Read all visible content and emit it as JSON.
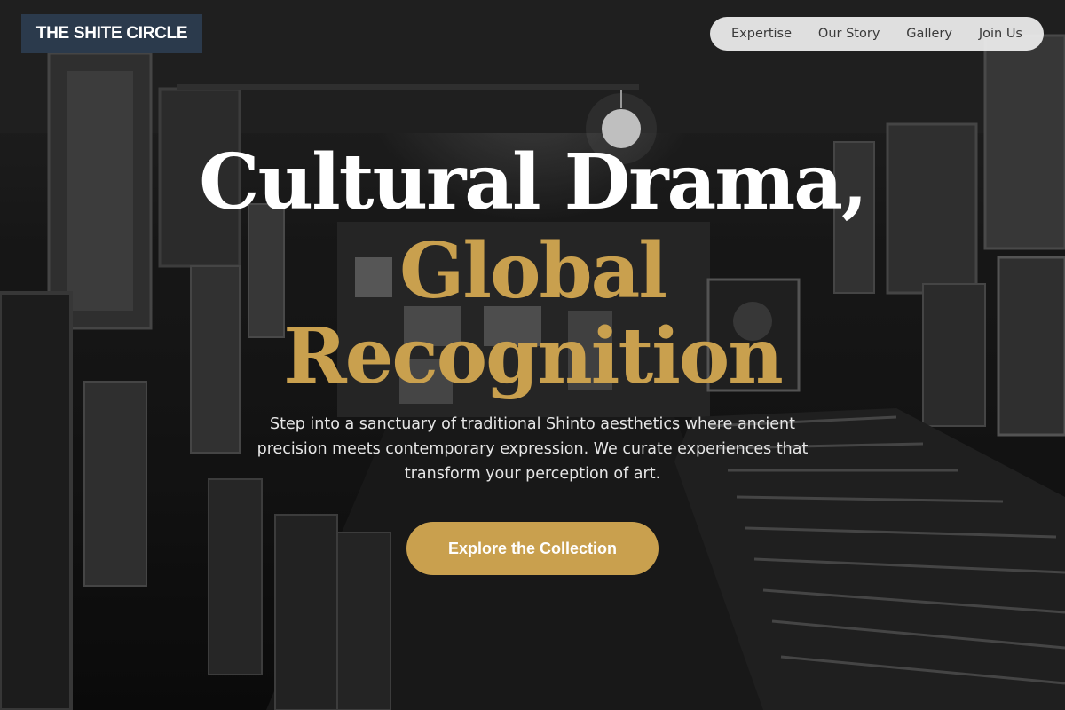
{
  "brand": {
    "logo_text": "THE SHITE CIRCLE",
    "logo_bg": "#2b3a4c"
  },
  "nav": {
    "items": [
      {
        "label": "Expertise"
      },
      {
        "label": "Our Story"
      },
      {
        "label": "Gallery"
      },
      {
        "label": "Join Us"
      }
    ]
  },
  "hero": {
    "headline_line1": "Cultural Drama,",
    "headline_line2": "Global",
    "headline_line3": "Recognition",
    "subtitle": "Step into a sanctuary of traditional Shinto aesthetics where ancient precision meets contemporary expression. We curate experiences that transform your perception of art.",
    "cta_label": "Explore the Collection",
    "background_image": "grayscale photo of a cluttered art gallery storeroom with stacked framed paintings"
  },
  "colors": {
    "accent_gold": "#c9a04e",
    "headline_white": "#ffffff",
    "nav_bg": "#f0f0f0"
  }
}
